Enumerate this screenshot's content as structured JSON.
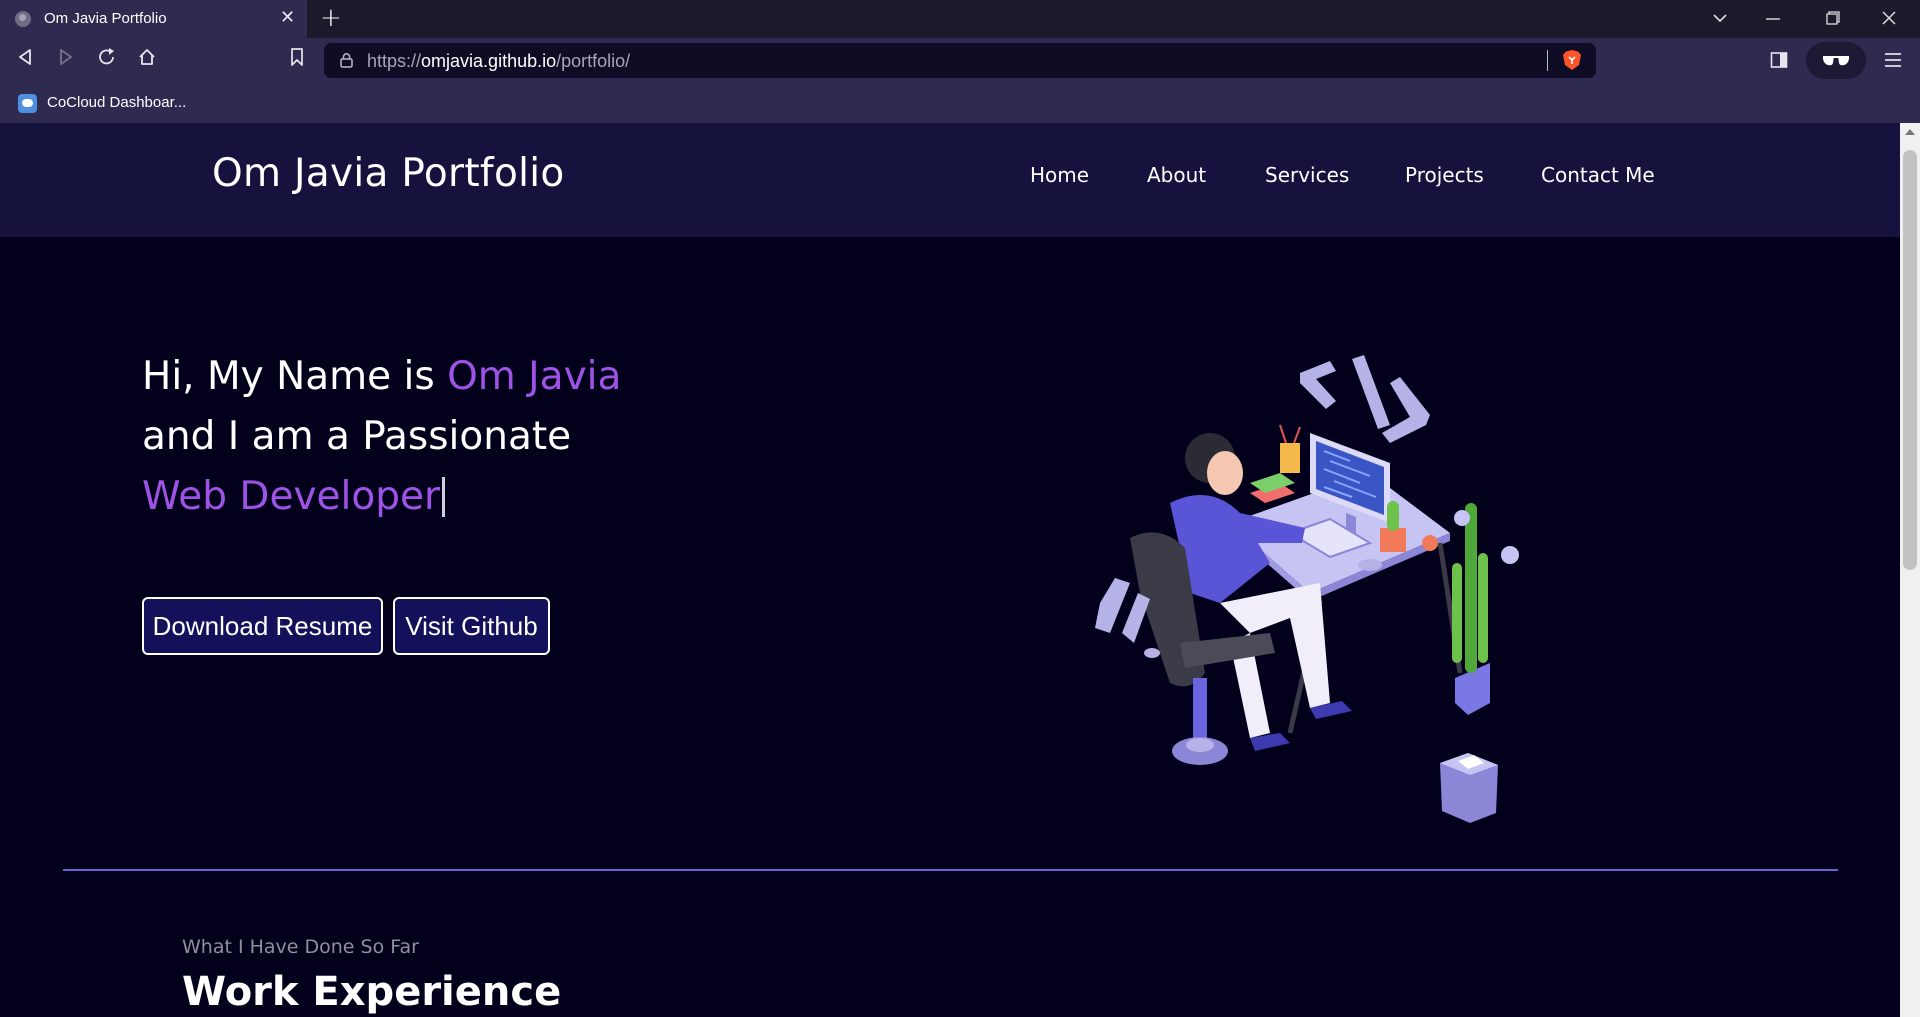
{
  "browser": {
    "tab_title": "Om Javia Portfolio",
    "tab_close": "✕",
    "new_tab": "+",
    "url_scheme": "https://",
    "url_host": "omjavia.github.io",
    "url_path": "/portfolio/",
    "bookmark_label": "CoCloud Dashboar..."
  },
  "site": {
    "logo": "Om Javia Portfolio",
    "nav": {
      "home": "Home",
      "about": "About",
      "services": "Services",
      "projects": "Projects",
      "contact": "Contact Me"
    }
  },
  "hero": {
    "line1_prefix": "Hi, My Name is ",
    "line1_name": "Om Javia",
    "line2": "and I am a Passionate",
    "line3_role": "Web Developer",
    "download_button": "Download Resume",
    "github_button": "Visit Github"
  },
  "experience": {
    "subtitle": "What I Have Done So Far",
    "title": "Work Experience"
  },
  "colors": {
    "accent": "#9f52e6",
    "header_bg": "#15133e",
    "page_bg": "#02001a",
    "button_bg": "#13115a",
    "divider": "#6a62d6"
  }
}
